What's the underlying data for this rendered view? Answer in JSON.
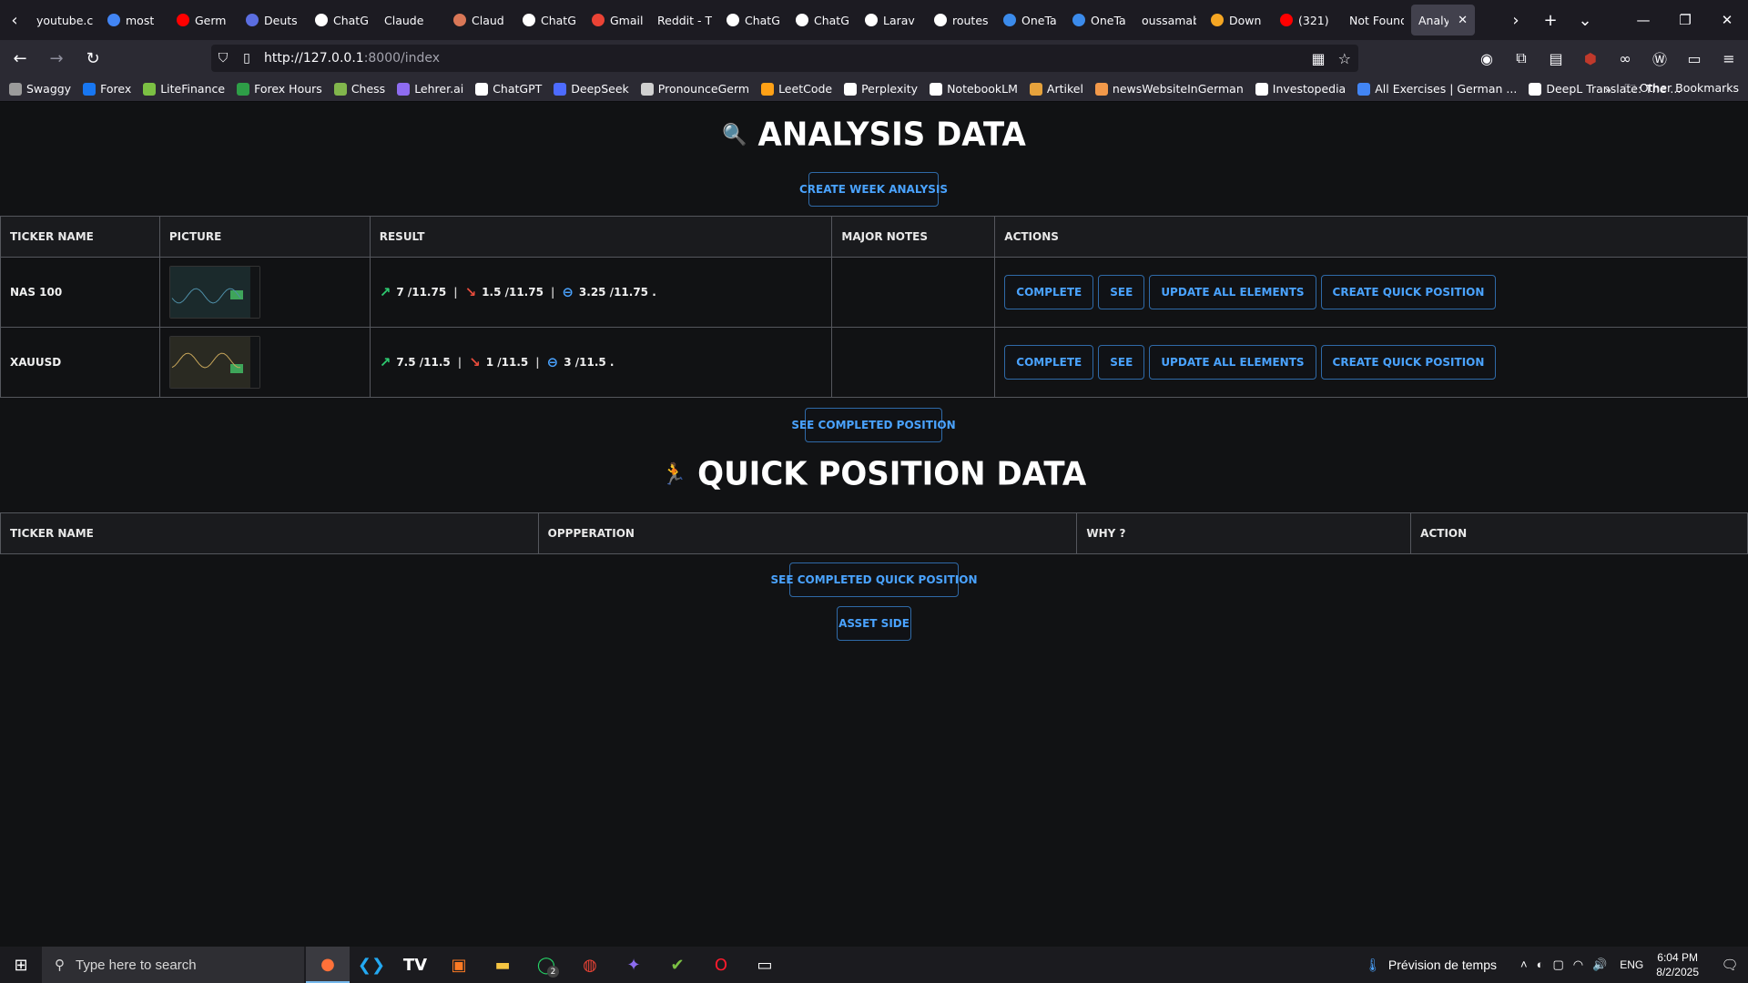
{
  "browser": {
    "tabs": [
      {
        "label": "youtube.c",
        "icon": "none",
        "color": ""
      },
      {
        "label": "most",
        "icon": "google-icon",
        "color": "#4285f4"
      },
      {
        "label": "Germ",
        "icon": "youtube-icon",
        "color": "#ff0000"
      },
      {
        "label": "Deuts",
        "icon": "page-icon",
        "color": "#5b6ee1"
      },
      {
        "label": "ChatG",
        "icon": "chatgpt-icon",
        "color": "#ffffff"
      },
      {
        "label": "Claude",
        "icon": "none",
        "color": ""
      },
      {
        "label": "Claud",
        "icon": "claude-icon",
        "color": "#d97757"
      },
      {
        "label": "ChatG",
        "icon": "chatgpt-icon",
        "color": "#ffffff"
      },
      {
        "label": "Gmail",
        "icon": "gmail-icon",
        "color": "#ea4335"
      },
      {
        "label": "Reddit - Th",
        "icon": "none",
        "color": ""
      },
      {
        "label": "ChatG",
        "icon": "chatgpt-icon",
        "color": "#ffffff"
      },
      {
        "label": "ChatG",
        "icon": "chatgpt-icon",
        "color": "#ffffff"
      },
      {
        "label": "Larav",
        "icon": "chatgpt-icon",
        "color": "#ffffff"
      },
      {
        "label": "routes",
        "icon": "arc-icon",
        "color": "#ffffff"
      },
      {
        "label": "OneTa",
        "icon": "onetab-icon",
        "color": "#3b8beb"
      },
      {
        "label": "OneTa",
        "icon": "onetab-icon",
        "color": "#3b8beb"
      },
      {
        "label": "oussamab",
        "icon": "none",
        "color": ""
      },
      {
        "label": "Down",
        "icon": "search-icon",
        "color": "#f5a623"
      },
      {
        "label": "(321)",
        "icon": "youtube-icon",
        "color": "#ff0000"
      },
      {
        "label": "Not Found",
        "icon": "none",
        "color": ""
      },
      {
        "label": "Analysis",
        "icon": "none",
        "color": "",
        "active": true
      }
    ],
    "url_host": "http://127.0.0.1",
    "url_rest": ":8000/index",
    "bookmarks": [
      {
        "label": "Swaggy",
        "icon": "globe-icon",
        "color": "#9b9b9b"
      },
      {
        "label": "Forex",
        "icon": "facebook-icon",
        "color": "#1877f2"
      },
      {
        "label": "LiteFinance",
        "icon": "litefinance-icon",
        "color": "#7bc043"
      },
      {
        "label": "Forex Hours",
        "icon": "forexhours-icon",
        "color": "#2e9e47"
      },
      {
        "label": "Chess",
        "icon": "chess-icon",
        "color": "#81b64c"
      },
      {
        "label": "Lehrer.ai",
        "icon": "lehrer-icon",
        "color": "#8e6cf0"
      },
      {
        "label": "ChatGPT",
        "icon": "chatgpt-icon",
        "color": "#ffffff"
      },
      {
        "label": "DeepSeek",
        "icon": "deepseek-icon",
        "color": "#4d6bfe"
      },
      {
        "label": "PronounceGerm",
        "icon": "pronounce-icon",
        "color": "#d0d0d0"
      },
      {
        "label": "LeetCode",
        "icon": "leetcode-icon",
        "color": "#ffa116"
      },
      {
        "label": "Perplexity",
        "icon": "perplexity-icon",
        "color": "#ffffff"
      },
      {
        "label": "NotebookLM",
        "icon": "notebooklm-icon",
        "color": "#ffffff"
      },
      {
        "label": "Artikel",
        "icon": "artikel-icon",
        "color": "#e6a23c"
      },
      {
        "label": "newsWebsiteInGerman",
        "icon": "news-icon",
        "color": "#f2994a"
      },
      {
        "label": "Investopedia",
        "icon": "investopedia-icon",
        "color": "#ffffff"
      },
      {
        "label": "All Exercises | German ...",
        "icon": "google-icon",
        "color": "#4285f4"
      },
      {
        "label": "DeepL Translate: The ...",
        "icon": "deepl-icon",
        "color": "#ffffff"
      }
    ],
    "other_bookmarks": "Other Bookmarks"
  },
  "page": {
    "analysis_title": "ANALYSIS DATA",
    "create_week_analysis": "CREATE WEEK ANALYSIS",
    "analysis_table": {
      "headers": [
        "TICKER NAME",
        "PICTURE",
        "RESULT",
        "MAJOR NOTES",
        "ACTIONS"
      ],
      "rows": [
        {
          "ticker": "NAS 100",
          "up": "7 /11.75",
          "down": "1.5 /11.75",
          "neutral": "3.25 /11.75 .",
          "notes": ""
        },
        {
          "ticker": "XAUUSD",
          "up": "7.5 /11.5",
          "down": "1 /11.5",
          "neutral": "3 /11.5 .",
          "notes": ""
        }
      ],
      "action_labels": [
        "COMPLETE",
        "SEE",
        "UPDATE ALL ELEMENTS",
        "CREATE QUICK POSITION"
      ]
    },
    "see_completed_position": "SEE COMPLETED POSITION",
    "quick_title": "QUICK POSITION DATA",
    "quick_table": {
      "headers": [
        "TICKER NAME",
        "OPPPERATION",
        "WHY ?",
        "ACTION"
      ]
    },
    "see_completed_quick": "SEE COMPLETED QUICK POSITION",
    "asset_side": "ASSET SIDE",
    "colors": {
      "accent": "#4aa3ff",
      "up": "#2ecc71",
      "down": "#e74c3c",
      "neutral": "#4aa3ff"
    }
  },
  "taskbar": {
    "search_placeholder": "Type here to search",
    "weather": "Prévision de temps",
    "lang": "ENG",
    "time": "6:04 PM",
    "date": "8/2/2025",
    "badge": "2"
  }
}
